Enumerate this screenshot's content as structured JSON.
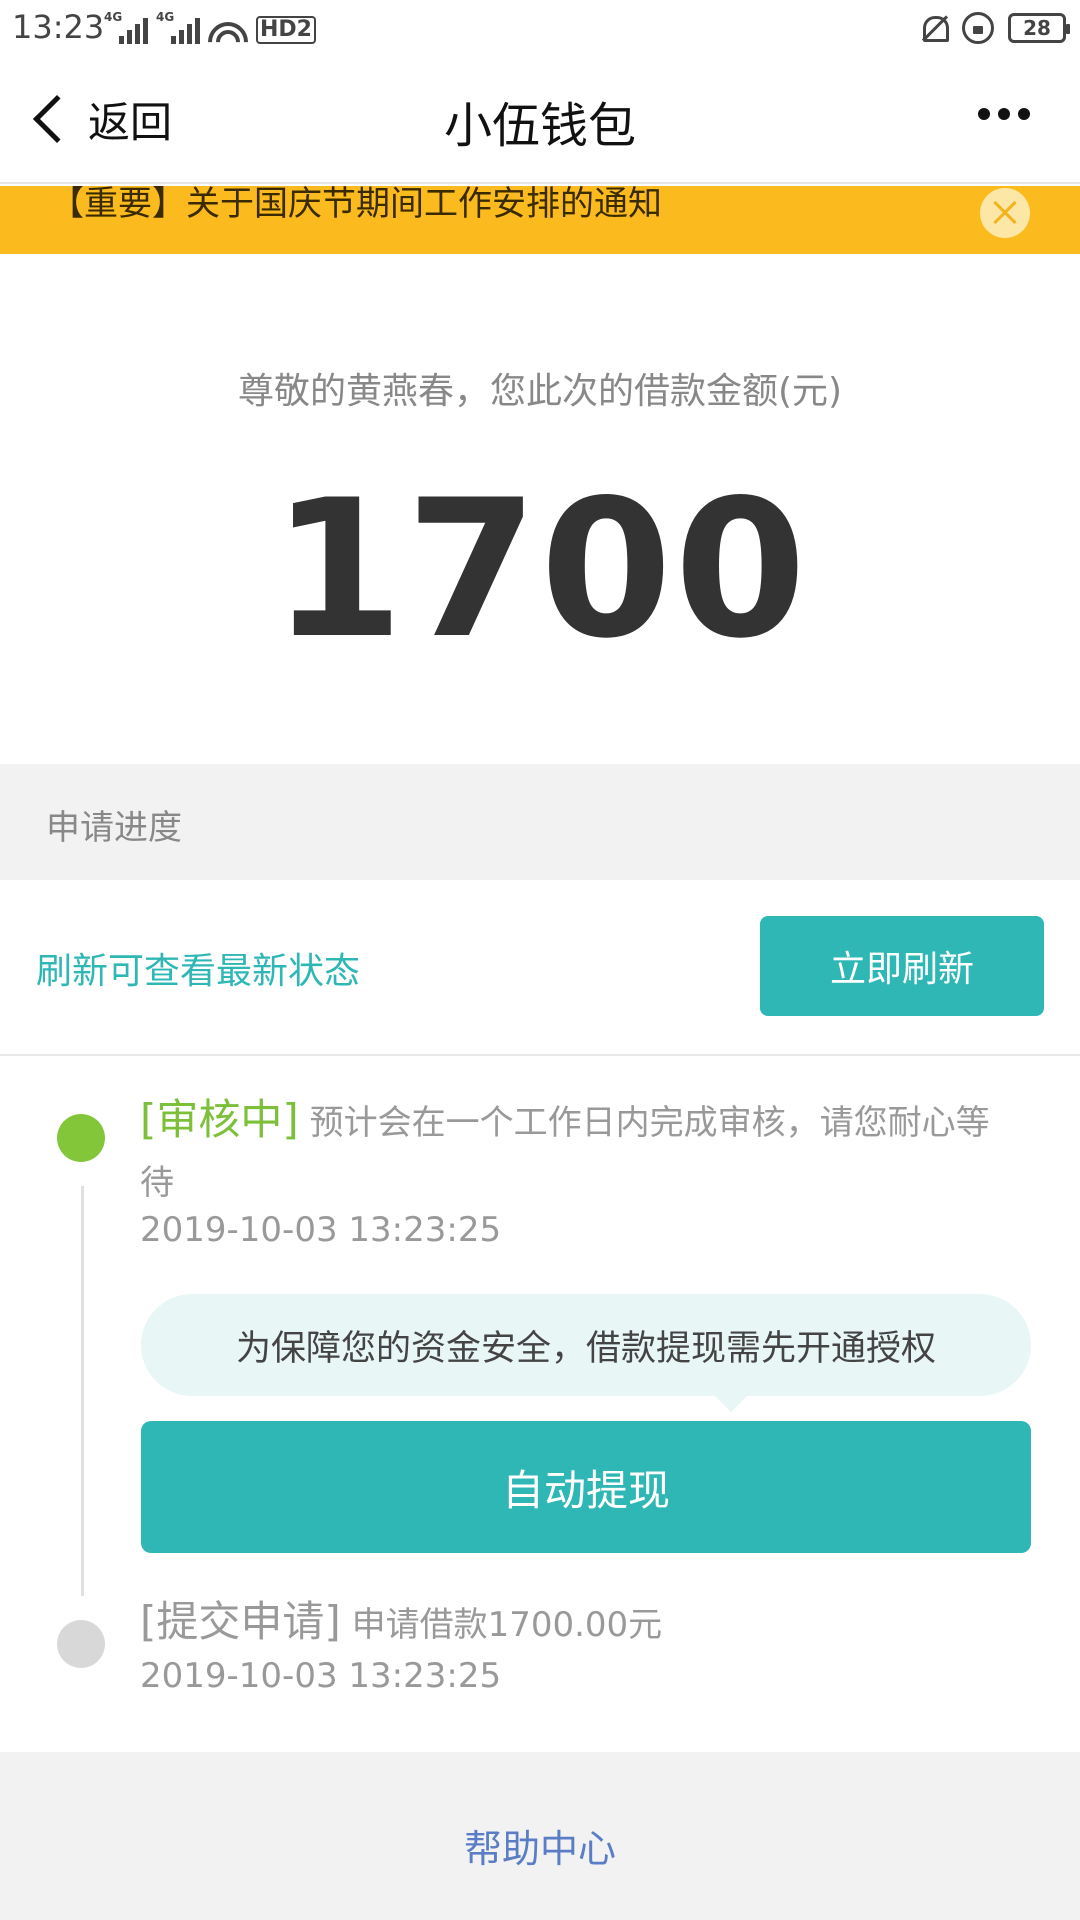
{
  "status_bar": {
    "time": "13:23",
    "network_1": "4G",
    "network_2": "4G",
    "hd_label": "HD2",
    "battery": "28"
  },
  "nav": {
    "back_label": "返回",
    "title": "小伍钱包",
    "more_icon": "more-dots-icon"
  },
  "notice": {
    "text": "【重要】关于国庆节期间工作安排的通知",
    "close_icon": "close-icon"
  },
  "loan": {
    "greeting": "尊敬的黄燕春，您此次的借款金额(元)",
    "amount": "1700"
  },
  "progress": {
    "section_title": "申请进度",
    "refresh_tip": "刷新可查看最新状态",
    "refresh_button": "立即刷新"
  },
  "timeline": {
    "step1": {
      "tag": "[审核中]",
      "text": " 预计会在一个工作日内完成审核，请您耐心等待",
      "time": "2019-10-03 13:23:25"
    },
    "bubble": "为保障您的资金安全，借款提现需先开通授权",
    "withdraw_button": "自动提现",
    "step2": {
      "tag": "[提交申请]",
      "text": " 申请借款1700.00元",
      "time": "2019-10-03 13:23:25"
    }
  },
  "footer": {
    "help": "帮助中心"
  },
  "colors": {
    "teal": "#2fb7b5",
    "notice_yellow": "#fbbb1e",
    "status_green": "#84c63a",
    "link_blue": "#5a7dc6"
  }
}
